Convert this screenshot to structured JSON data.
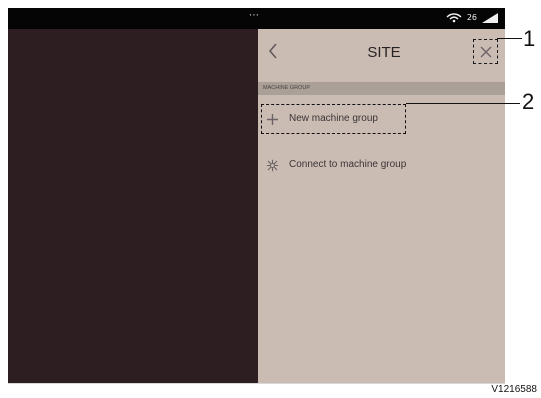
{
  "status_bar": {
    "center_indicator": "⋯",
    "wifi_icon": "wifi-icon",
    "status_text": "26",
    "signal_icon": "signal-icon"
  },
  "site_panel": {
    "title": "SITE",
    "back_icon": "chevron-left-icon",
    "close_icon": "close-icon",
    "section_header": "MACHINE GROUP",
    "items": [
      {
        "icon": "plus-icon",
        "label": "New machine group"
      },
      {
        "icon": "connect-icon",
        "label": "Connect to machine group"
      }
    ]
  },
  "callouts": {
    "close_number": "1",
    "new_group_number": "2"
  },
  "figure": {
    "code": "V1216588"
  },
  "colors": {
    "main_background": "#2d1f21",
    "panel_background": "#cbbcb3",
    "section_background": "#aba097",
    "status_bar": "#050505"
  }
}
